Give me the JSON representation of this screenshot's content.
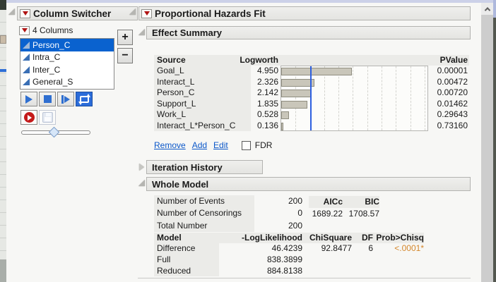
{
  "colors": {
    "accent_blue": "#2d5fe0",
    "selection_blue": "#0a62cf",
    "link_blue": "#0b57c9",
    "significant_orange": "#d4872c",
    "bar_fill": "#c9c6ba",
    "header_gray": "#ebebe8"
  },
  "column_switcher": {
    "title": "Column Switcher",
    "columns_count": "4 Columns",
    "items": [
      "Person_C",
      "Intra_C",
      "Inter_C",
      "General_S"
    ],
    "selected_item": "Person_C",
    "add_label": "+",
    "remove_label": "−"
  },
  "report": {
    "title": "Proportional Hazards Fit",
    "effect_summary": {
      "title": "Effect Summary",
      "col_source": "Source",
      "col_logworth": "Logworth",
      "col_pvalue": "PValue",
      "rows": [
        {
          "source": "Goal_L",
          "logworth": "4.950",
          "logworth_value": 4.95,
          "pvalue": "0.00001"
        },
        {
          "source": "Interact_L",
          "logworth": "2.326",
          "logworth_value": 2.326,
          "pvalue": "0.00472"
        },
        {
          "source": "Person_C",
          "logworth": "2.142",
          "logworth_value": 2.142,
          "pvalue": "0.00720"
        },
        {
          "source": "Support_L",
          "logworth": "1.835",
          "logworth_value": 1.835,
          "pvalue": "0.01462"
        },
        {
          "source": "Work_L",
          "logworth": "0.528",
          "logworth_value": 0.528,
          "pvalue": "0.29643"
        },
        {
          "source": "Interact_L*Person_C",
          "logworth": "0.136",
          "logworth_value": 0.136,
          "pvalue": "0.73160"
        }
      ],
      "chart_axis": {
        "min": 0,
        "max": 10.2,
        "gridline_step": 1,
        "threshold": 2
      },
      "link_remove": "Remove",
      "link_add": "Add",
      "link_edit": "Edit",
      "fdr_label": "FDR"
    },
    "iteration_history": {
      "title": "Iteration History"
    },
    "whole_model": {
      "title": "Whole Model",
      "counts": [
        {
          "label": "Number of Events",
          "value": "200"
        },
        {
          "label": "Number of Censorings",
          "value": "0"
        },
        {
          "label": "Total Number",
          "value": "200"
        }
      ],
      "aic": {
        "h1": "AICc",
        "h2": "BIC",
        "v1": "1689.22",
        "v2": "1708.57"
      },
      "model_table": {
        "h_model": "Model",
        "h_loglik": "-LogLikelihood",
        "h_chisq": "ChiSquare",
        "h_df": "DF",
        "h_prob": "Prob>Chisq",
        "rows": [
          {
            "model": "Difference",
            "loglik": "46.4239",
            "chisq": "92.8477",
            "df": "6",
            "prob": "<.0001*"
          },
          {
            "model": "Full",
            "loglik": "838.3899",
            "chisq": "",
            "df": "",
            "prob": ""
          },
          {
            "model": "Reduced",
            "loglik": "884.8138",
            "chisq": "",
            "df": "",
            "prob": ""
          }
        ]
      }
    }
  }
}
